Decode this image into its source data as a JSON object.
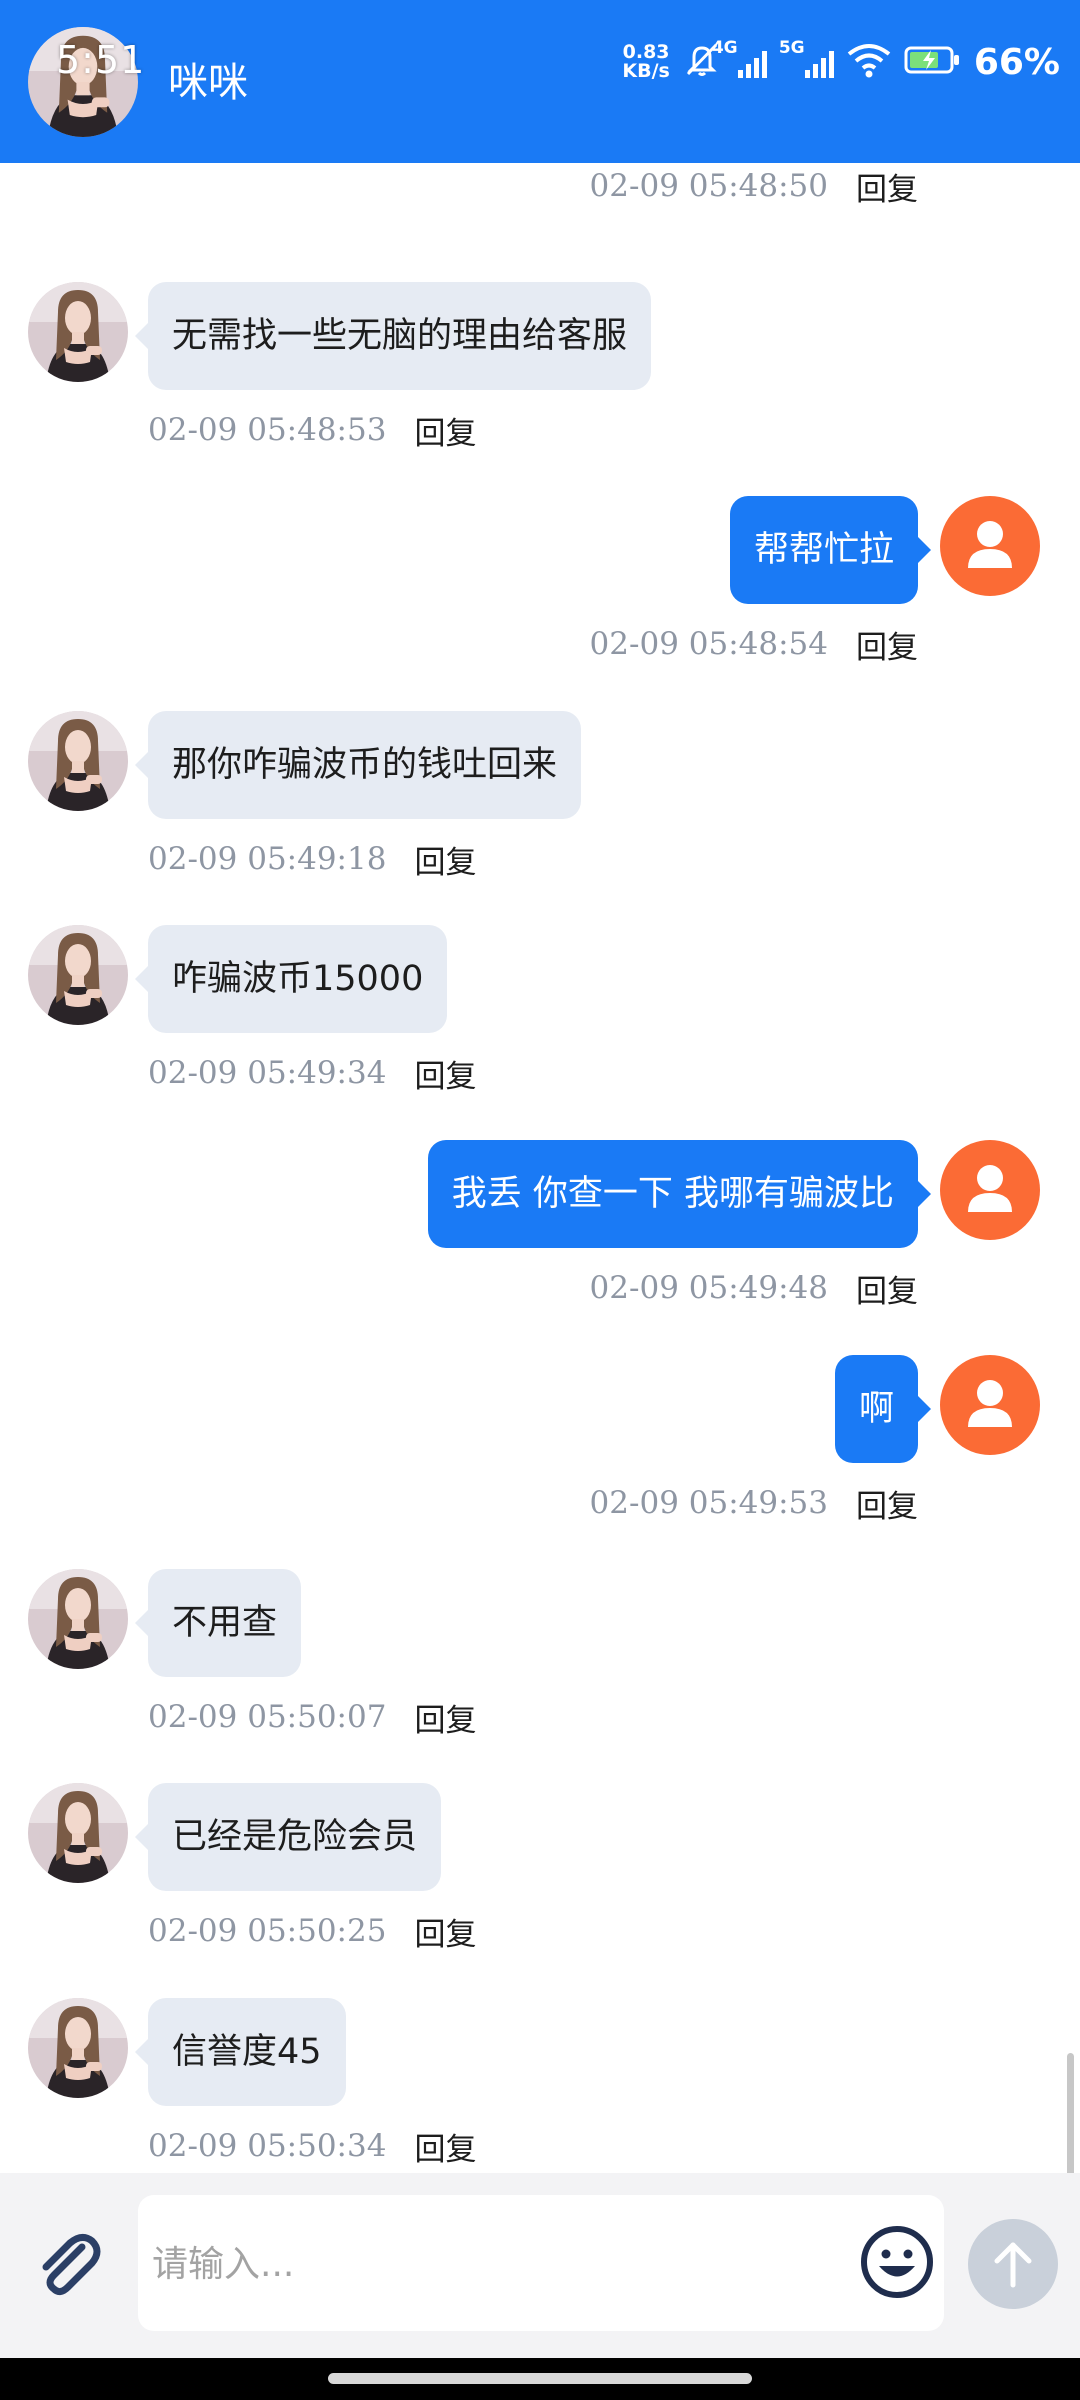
{
  "status_bar": {
    "time": "5:51",
    "net_speed_value": "0.83",
    "net_speed_unit": "KB/s",
    "network_1": "4G",
    "network_2": "5G",
    "battery_percent": "66%"
  },
  "header": {
    "title": "咪咪"
  },
  "reply_label": "回复",
  "messages": [
    {
      "side": "right",
      "text": "",
      "time": "02-09 05:48:50"
    },
    {
      "side": "left",
      "text": "无需找一些无脑的理由给客服",
      "time": "02-09 05:48:53"
    },
    {
      "side": "right",
      "text": "帮帮忙拉",
      "time": "02-09 05:48:54"
    },
    {
      "side": "left",
      "text": "那你咋骗波币的钱吐回来",
      "time": "02-09 05:49:18"
    },
    {
      "side": "left",
      "text": "咋骗波币15000",
      "time": "02-09 05:49:34"
    },
    {
      "side": "right",
      "text": "我丢 你查一下 我哪有骗波比",
      "time": "02-09 05:49:48"
    },
    {
      "side": "right",
      "text": "啊",
      "time": "02-09 05:49:53"
    },
    {
      "side": "left",
      "text": "不用查",
      "time": "02-09 05:50:07"
    },
    {
      "side": "left",
      "text": "已经是危险会员",
      "time": "02-09 05:50:25"
    },
    {
      "side": "left",
      "text": "信誉度45",
      "time": "02-09 05:50:34"
    }
  ],
  "input": {
    "placeholder": "请输入..."
  },
  "icons": {
    "attach": "paperclip-icon",
    "emoji": "smiley-icon",
    "send": "arrow-up-icon",
    "user": "user-icon"
  },
  "colors": {
    "accent": "#1a7af5",
    "incoming_bubble": "#e6ebf3",
    "user_avatar": "#fb6b35",
    "send_disabled": "#c9d0da"
  }
}
